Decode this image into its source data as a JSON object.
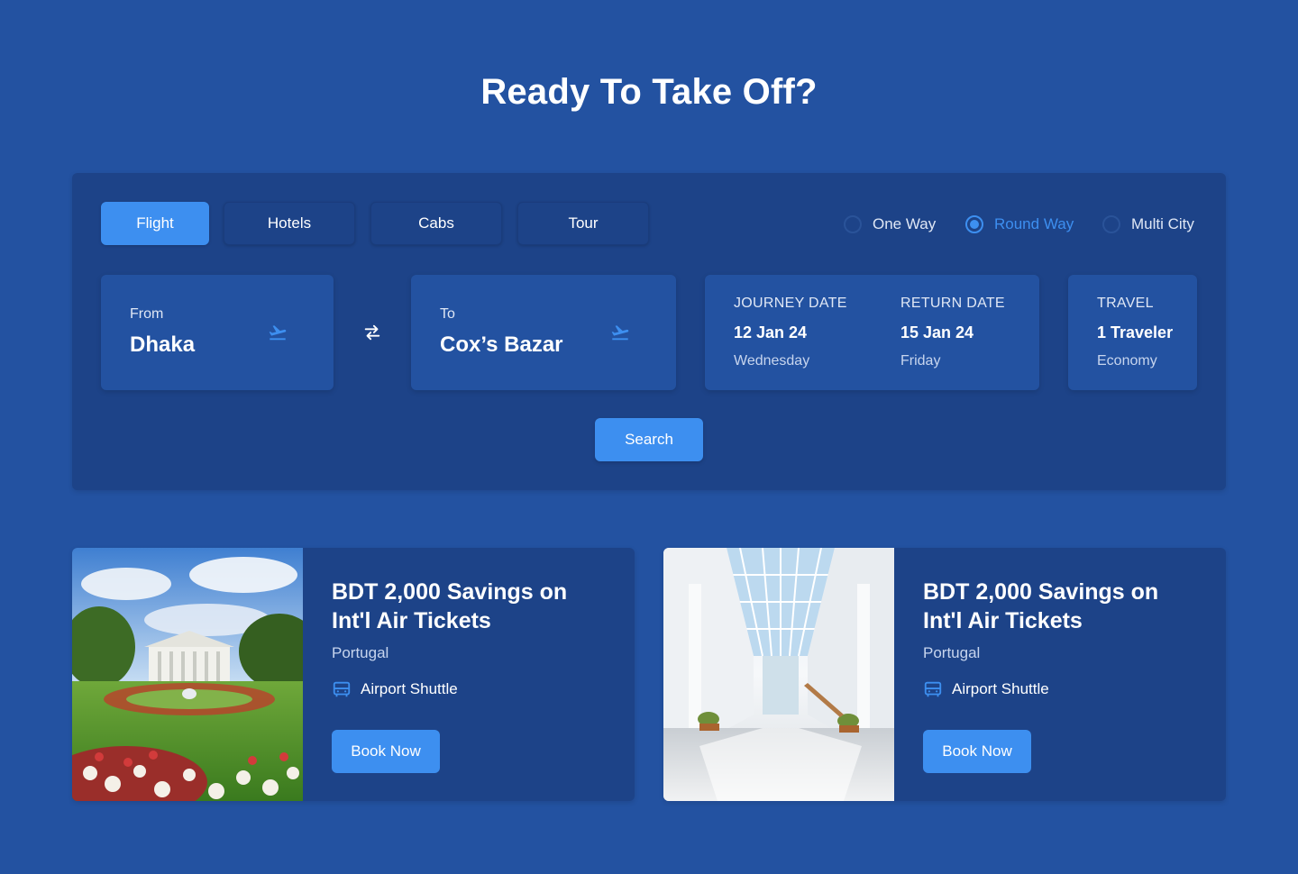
{
  "page": {
    "title": "Ready To Take Off?"
  },
  "tabs": [
    {
      "label": "Flight",
      "active": true
    },
    {
      "label": "Hotels",
      "active": false
    },
    {
      "label": "Cabs",
      "active": false
    },
    {
      "label": "Tour",
      "active": false
    }
  ],
  "trip_types": [
    {
      "label": "One Way",
      "selected": false
    },
    {
      "label": "Round Way",
      "selected": true
    },
    {
      "label": "Multi City",
      "selected": false
    }
  ],
  "from": {
    "label": "From",
    "value": "Dhaka",
    "icon": "plane-takeoff-icon"
  },
  "to": {
    "label": "To",
    "value": "Cox’s Bazar",
    "icon": "plane-takeoff-icon"
  },
  "dates": {
    "journey": {
      "label": "JOURNEY DATE",
      "date": "12 Jan 24",
      "day": "Wednesday"
    },
    "return": {
      "label": "RETURN DATE",
      "date": "15 Jan 24",
      "day": "Friday"
    }
  },
  "travel": {
    "label": "TRAVEL",
    "travelers": "1 Traveler",
    "class": "Economy"
  },
  "search_label": "Search",
  "offers": [
    {
      "title": "BDT 2,000 Savings on Int'l Air Tickets",
      "location": "Portugal",
      "feature": "Airport Shuttle",
      "feature_icon": "bus-icon",
      "button": "Book Now",
      "image": "garden-palace-photo"
    },
    {
      "title": "BDT 2,000 Savings on Int'l Air Tickets",
      "location": "Portugal",
      "feature": "Airport Shuttle",
      "feature_icon": "bus-icon",
      "button": "Book Now",
      "image": "airport-terminal-photo"
    }
  ],
  "colors": {
    "background": "#2352a1",
    "panel": "#1d4388",
    "accent": "#3d8ff0"
  }
}
